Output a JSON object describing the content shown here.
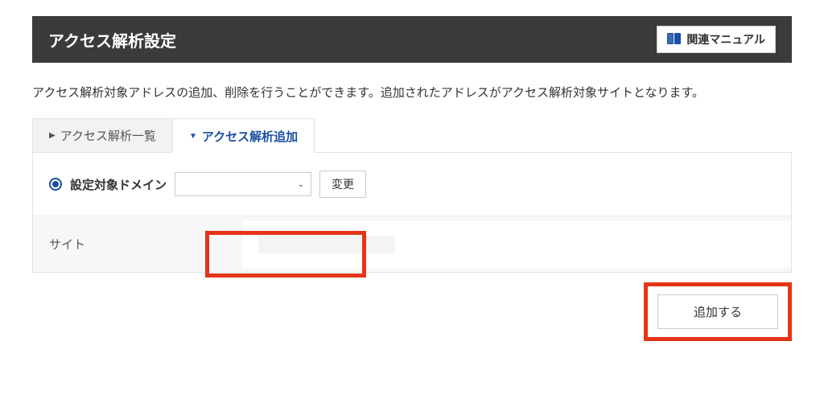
{
  "header": {
    "title": "アクセス解析設定",
    "manual_label": "関連マニュアル"
  },
  "description": "アクセス解析対象アドレスの追加、削除を行うことができます。追加されたアドレスがアクセス解析対象サイトとなります。",
  "tabs": {
    "list_label": "アクセス解析一覧",
    "add_label": "アクセス解析追加"
  },
  "form": {
    "domain_label": "設定対象ドメイン",
    "domain_value": "",
    "change_label": "変更",
    "site_label": "サイト",
    "site_value": ""
  },
  "actions": {
    "add_label": "追加する"
  }
}
